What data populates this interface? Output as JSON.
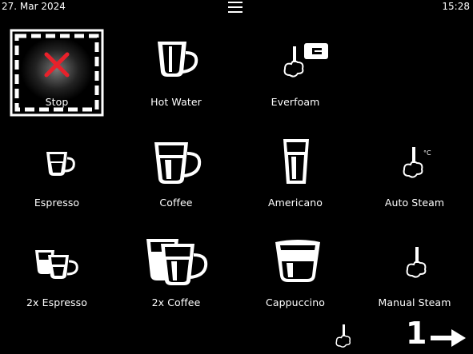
{
  "status": {
    "date": "27. Mar 2024",
    "time": "15:28"
  },
  "products": [
    {
      "label": "Stop",
      "icon": "stop-x-icon"
    },
    {
      "label": "Hot Water",
      "icon": "hot-water-cup-icon"
    },
    {
      "label": "Everfoam",
      "icon": "everfoam-icon"
    },
    {
      "label": "Espresso",
      "icon": "espresso-cup-icon"
    },
    {
      "label": "Coffee",
      "icon": "coffee-cup-icon"
    },
    {
      "label": "Americano",
      "icon": "americano-glass-icon"
    },
    {
      "label": "Auto Steam",
      "icon": "auto-steam-icon"
    },
    {
      "label": "2x Espresso",
      "icon": "double-espresso-icon"
    },
    {
      "label": "2x Coffee",
      "icon": "double-coffee-icon"
    },
    {
      "label": "Cappuccino",
      "icon": "cappuccino-glass-icon"
    },
    {
      "label": "Manual Steam",
      "icon": "manual-steam-icon"
    }
  ],
  "pager": {
    "page_number": "1"
  },
  "colors": {
    "background": "#000000",
    "foreground": "#ffffff",
    "stop_red": "#e8212b"
  },
  "units": {
    "auto_steam_unit": "°C"
  }
}
